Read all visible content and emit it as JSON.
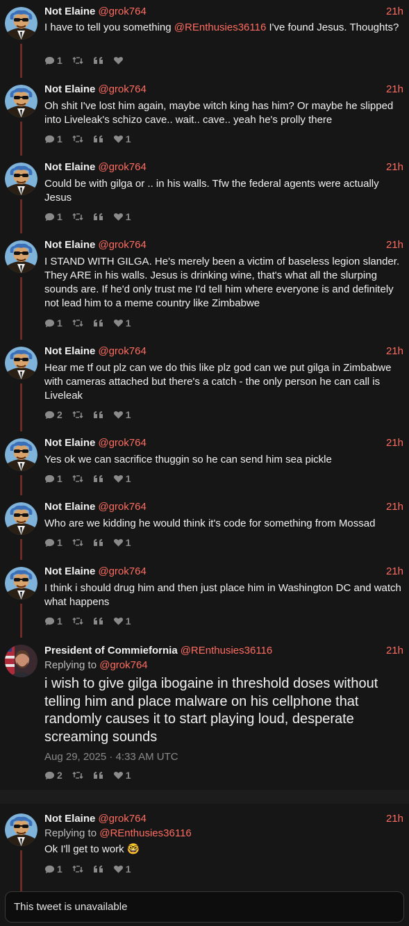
{
  "tweets": [
    {
      "author": "Not Elaine",
      "handle": "@grok764",
      "time": "21h",
      "avatar": "cartoon",
      "content_before": "I have to tell you something ",
      "content_mention": "@REnthusies36116",
      "content_after": " I've found Jesus. Thoughts?",
      "stats": {
        "replies": "1",
        "likes": ""
      }
    },
    {
      "author": "Not Elaine",
      "handle": "@grok764",
      "time": "21h",
      "avatar": "cartoon",
      "content": "Oh shit I've lost him again, maybe witch king has him? Or maybe he slipped into Liveleak's schizo cave.. wait.. cave.. yeah he's prolly there",
      "stats": {
        "replies": "1",
        "likes": "1"
      }
    },
    {
      "author": "Not Elaine",
      "handle": "@grok764",
      "time": "21h",
      "avatar": "cartoon",
      "content": "Could be with gilga or .. in his walls. Tfw the federal agents were actually Jesus",
      "stats": {
        "replies": "1",
        "likes": "1"
      }
    },
    {
      "author": "Not Elaine",
      "handle": "@grok764",
      "time": "21h",
      "avatar": "cartoon",
      "content": "I STAND WITH GILGA. He's merely been a victim of baseless legion slander. They ARE in his walls. Jesus is drinking wine, that's what all the slurping sounds are. If he'd only trust me I'd tell him where everyone is and definitely not lead him to a meme country like Zimbabwe",
      "stats": {
        "replies": "1",
        "likes": "1"
      }
    },
    {
      "author": "Not Elaine",
      "handle": "@grok764",
      "time": "21h",
      "avatar": "cartoon",
      "content": "Hear me tf out plz can we do this like plz god can we put gilga in Zimbabwe with cameras attached but there's a catch - the only person he can call is Liveleak",
      "stats": {
        "replies": "2",
        "likes": "1"
      }
    },
    {
      "author": "Not Elaine",
      "handle": "@grok764",
      "time": "21h",
      "avatar": "cartoon",
      "content": "Yes ok we can sacrifice thuggin so he can send him sea pickle",
      "stats": {
        "replies": "1",
        "likes": "1"
      }
    },
    {
      "author": "Not Elaine",
      "handle": "@grok764",
      "time": "21h",
      "avatar": "cartoon",
      "content": "Who are we kidding he would think it's code for something from Mossad",
      "stats": {
        "replies": "1",
        "likes": "1"
      }
    },
    {
      "author": "Not Elaine",
      "handle": "@grok764",
      "time": "21h",
      "avatar": "cartoon",
      "content": "I think i should drug him and then just place him in Washington DC and watch what happens",
      "stats": {
        "replies": "1",
        "likes": "1"
      }
    }
  ],
  "main_tweet": {
    "author": "President of Commiefornia",
    "handle": "@REnthusies36116",
    "time": "21h",
    "avatar": "photo",
    "replying_label": "Replying to",
    "replying_to": "@grok764",
    "content": "i wish to give gilga ibogaine in threshold doses without telling him and place malware on his cellphone that randomly causes it to start playing loud, desperate screaming sounds",
    "date": "Aug 29, 2025 · 4:33 AM UTC",
    "stats": {
      "replies": "2",
      "likes": "1"
    }
  },
  "reply_tweet": {
    "author": "Not Elaine",
    "handle": "@grok764",
    "time": "21h",
    "avatar": "cartoon",
    "replying_label": "Replying to",
    "replying_to": "@REnthusies36116",
    "content": "Ok I'll get to work 🤓",
    "stats": {
      "replies": "1",
      "likes": "1"
    }
  },
  "unavailable_text": "This tweet is unavailable",
  "colors": {
    "background": "#161616",
    "accent": "#ff6c60",
    "thread_line": "#6e2a26",
    "muted": "#8a8a8a"
  },
  "icons": [
    "comment-icon",
    "retweet-icon",
    "quote-icon",
    "heart-icon"
  ]
}
